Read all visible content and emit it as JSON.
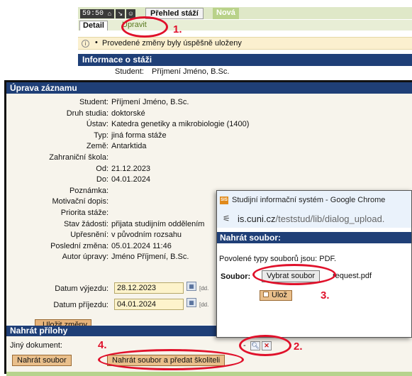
{
  "header": {
    "timer": "59:50",
    "icons": [
      "home-icon",
      "scroll-icon",
      "person-icon"
    ],
    "tab_main": "Přehled stáží",
    "tab_new": "Nová",
    "subtab_detail": "Detail",
    "subtab_edit": "Upravit"
  },
  "notice": {
    "icon": "info-icon",
    "bullet": "•",
    "text": "Provedené změny byly úspěšně uloženy"
  },
  "info_section": {
    "title": "Informace o stáži",
    "student_label": "Student:",
    "student_value": "Příjmení Jméno, B.Sc."
  },
  "edit_section": {
    "title": "Úprava záznamu",
    "rows": [
      {
        "label": "Student:",
        "value": "Příjmení Jméno, B.Sc."
      },
      {
        "label": "Druh studia:",
        "value": "doktorské"
      },
      {
        "label": "Ústav:",
        "value": "Katedra genetiky a mikrobiologie (1400)"
      },
      {
        "label": "Typ:",
        "value": "jiná forma stáže"
      },
      {
        "label": "Země:",
        "value": "Antarktida"
      },
      {
        "label": "Zahraniční škola:",
        "value": ""
      },
      {
        "label": "Od:",
        "value": "21.12.2023"
      },
      {
        "label": "Do:",
        "value": "04.01.2024"
      },
      {
        "label": "Poznámka:",
        "value": ""
      },
      {
        "label": "Motivační dopis:",
        "value": ""
      },
      {
        "label": "Priorita stáže:",
        "value": ""
      },
      {
        "label": "Stav žádosti:",
        "value": "přijata studijním oddělením"
      },
      {
        "label": "Upřesnění:",
        "value": "v původním rozsahu"
      },
      {
        "label": "Poslední změna:",
        "value": "05.01.2024 11:46"
      },
      {
        "label": "Autor úpravy:",
        "value": "Jméno Příjmení, B.Sc."
      }
    ],
    "departure_label": "Datum výjezdu:",
    "departure_value": "28.12.2023",
    "arrival_label": "Datum příjezdu:",
    "arrival_value": "04.01.2024",
    "date_format_hint": "[dd.",
    "save_label": "Uložit změny"
  },
  "attachments": {
    "title": "Nahrát přílohy",
    "other_doc_label": "Jiný dokument:",
    "dash": "-",
    "upload_label": "Nahrát soubor",
    "upload_submit_label": "Nahrát soubor a předat školiteli"
  },
  "popup": {
    "window_title": "Studijní informační systém - Google Chrome",
    "sis_icon_text": "SIS",
    "url_host": "is.cuni.cz",
    "url_path": "/teststud/lib/dialog_upload.",
    "heading": "Nahrát soubor:",
    "allowed_types": "Povolené typy souborů jsou: PDF.",
    "file_label": "Soubor:",
    "choose_label": "Vybrat soubor",
    "file_name": "request.pdf",
    "save_label": "Ulož"
  },
  "annotations": {
    "step1": "1.",
    "step2": "2.",
    "step3": "3.",
    "step4": "4.",
    "color": "#e0112b"
  },
  "colors": {
    "header_blue": "#1f3f77",
    "button_tan": "#e9bf8b",
    "input_yellow": "#fdf3cb",
    "notice_yellow": "#fbf0cf",
    "tab_green": "#b9d28a"
  }
}
